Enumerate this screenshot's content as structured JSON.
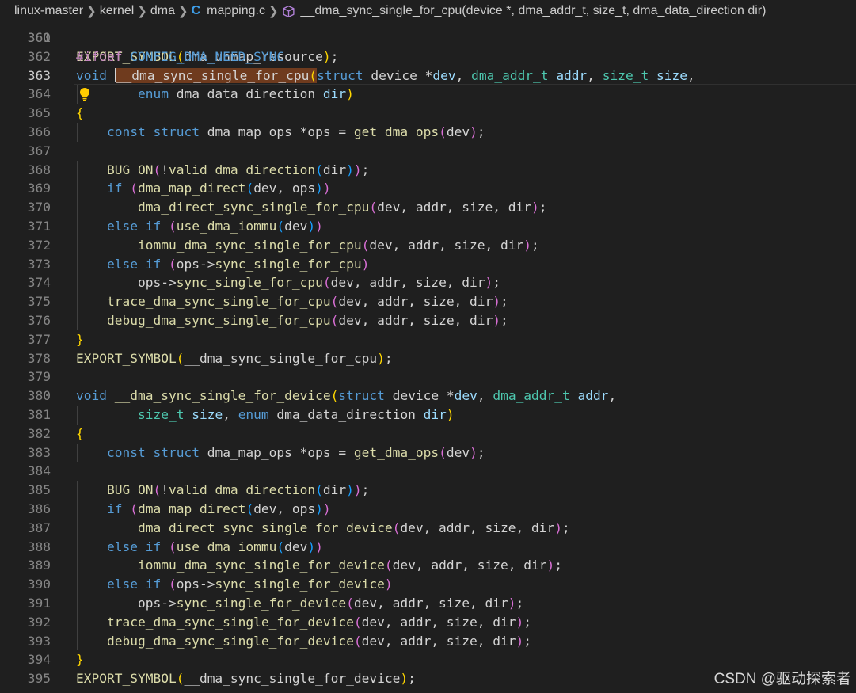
{
  "breadcrumb": {
    "items": [
      "linux-master",
      "kernel",
      "dma",
      "mapping.c",
      "__dma_sync_single_for_cpu(device *, dma_addr_t, size_t, dma_data_direction dir)"
    ],
    "icons": {
      "file": "c-language-file-icon",
      "symbol": "function-cube-icon"
    }
  },
  "partial_top_line": {
    "text": "EXPORT_SYMBOL(dma_unmap_resource);"
  },
  "editor": {
    "cursor_line": "363",
    "lightbulb_line": "364",
    "selected_text": "__dma_sync_single_for_cpu(",
    "lines": [
      {
        "n": "361",
        "t": []
      },
      {
        "n": "362",
        "t": [
          [
            "pp",
            "#ifdef"
          ],
          [
            "tx",
            " "
          ],
          [
            "mac",
            "CONFIG_DMA_NEED_SYNC"
          ]
        ]
      },
      {
        "n": "363",
        "t": [
          [
            "kw",
            "void"
          ],
          [
            "tx",
            " "
          ],
          [
            "cursor",
            ""
          ],
          [
            "sel",
            "__dma_sync_single_for_cpu"
          ],
          [
            "sel b1",
            "("
          ],
          [
            "kw",
            "struct"
          ],
          [
            "tx",
            " device *"
          ],
          [
            "pm",
            "dev"
          ],
          [
            "tx",
            ", "
          ],
          [
            "ty",
            "dma_addr_t"
          ],
          [
            "tx",
            " "
          ],
          [
            "pm",
            "addr"
          ],
          [
            "tx",
            ", "
          ],
          [
            "ty",
            "size_t"
          ],
          [
            "tx",
            " "
          ],
          [
            "pm",
            "size"
          ],
          [
            "tx",
            ","
          ]
        ]
      },
      {
        "n": "364",
        "t": [
          [
            "tx",
            "        "
          ],
          [
            "kw",
            "enum"
          ],
          [
            "tx",
            " dma_data_direction "
          ],
          [
            "pm",
            "dir"
          ],
          [
            "b1",
            ")"
          ]
        ]
      },
      {
        "n": "365",
        "t": [
          [
            "b1",
            "{"
          ]
        ]
      },
      {
        "n": "366",
        "t": [
          [
            "tx",
            "    "
          ],
          [
            "kw",
            "const"
          ],
          [
            "tx",
            " "
          ],
          [
            "kw",
            "struct"
          ],
          [
            "tx",
            " dma_map_ops *ops = "
          ],
          [
            "fn",
            "get_dma_ops"
          ],
          [
            "b2",
            "("
          ],
          [
            "tx",
            "dev"
          ],
          [
            "b2",
            ")"
          ],
          [
            "tx",
            ";"
          ]
        ]
      },
      {
        "n": "367",
        "t": []
      },
      {
        "n": "368",
        "t": [
          [
            "tx",
            "    "
          ],
          [
            "fn",
            "BUG_ON"
          ],
          [
            "b2",
            "("
          ],
          [
            "tx",
            "!"
          ],
          [
            "fn",
            "valid_dma_direction"
          ],
          [
            "b3",
            "("
          ],
          [
            "tx",
            "dir"
          ],
          [
            "b3",
            ")"
          ],
          [
            "b2",
            ")"
          ],
          [
            "tx",
            ";"
          ]
        ]
      },
      {
        "n": "369",
        "t": [
          [
            "tx",
            "    "
          ],
          [
            "kw",
            "if"
          ],
          [
            "tx",
            " "
          ],
          [
            "b2",
            "("
          ],
          [
            "fn",
            "dma_map_direct"
          ],
          [
            "b3",
            "("
          ],
          [
            "tx",
            "dev, ops"
          ],
          [
            "b3",
            ")"
          ],
          [
            "b2",
            ")"
          ]
        ]
      },
      {
        "n": "370",
        "t": [
          [
            "tx",
            "        "
          ],
          [
            "fn",
            "dma_direct_sync_single_for_cpu"
          ],
          [
            "b2",
            "("
          ],
          [
            "tx",
            "dev, addr, size, dir"
          ],
          [
            "b2",
            ")"
          ],
          [
            "tx",
            ";"
          ]
        ]
      },
      {
        "n": "371",
        "t": [
          [
            "tx",
            "    "
          ],
          [
            "kw",
            "else"
          ],
          [
            "tx",
            " "
          ],
          [
            "kw",
            "if"
          ],
          [
            "tx",
            " "
          ],
          [
            "b2",
            "("
          ],
          [
            "fn",
            "use_dma_iommu"
          ],
          [
            "b3",
            "("
          ],
          [
            "tx",
            "dev"
          ],
          [
            "b3",
            ")"
          ],
          [
            "b2",
            ")"
          ]
        ]
      },
      {
        "n": "372",
        "t": [
          [
            "tx",
            "        "
          ],
          [
            "fn",
            "iommu_dma_sync_single_for_cpu"
          ],
          [
            "b2",
            "("
          ],
          [
            "tx",
            "dev, addr, size, dir"
          ],
          [
            "b2",
            ")"
          ],
          [
            "tx",
            ";"
          ]
        ]
      },
      {
        "n": "373",
        "t": [
          [
            "tx",
            "    "
          ],
          [
            "kw",
            "else"
          ],
          [
            "tx",
            " "
          ],
          [
            "kw",
            "if"
          ],
          [
            "tx",
            " "
          ],
          [
            "b2",
            "("
          ],
          [
            "tx",
            "ops->"
          ],
          [
            "fn",
            "sync_single_for_cpu"
          ],
          [
            "b2",
            ")"
          ]
        ]
      },
      {
        "n": "374",
        "t": [
          [
            "tx",
            "        ops->"
          ],
          [
            "fn",
            "sync_single_for_cpu"
          ],
          [
            "b2",
            "("
          ],
          [
            "tx",
            "dev, addr, size, dir"
          ],
          [
            "b2",
            ")"
          ],
          [
            "tx",
            ";"
          ]
        ]
      },
      {
        "n": "375",
        "t": [
          [
            "tx",
            "    "
          ],
          [
            "fn",
            "trace_dma_sync_single_for_cpu"
          ],
          [
            "b2",
            "("
          ],
          [
            "tx",
            "dev, addr, size, dir"
          ],
          [
            "b2",
            ")"
          ],
          [
            "tx",
            ";"
          ]
        ]
      },
      {
        "n": "376",
        "t": [
          [
            "tx",
            "    "
          ],
          [
            "fn",
            "debug_dma_sync_single_for_cpu"
          ],
          [
            "b2",
            "("
          ],
          [
            "tx",
            "dev, addr, size, dir"
          ],
          [
            "b2",
            ")"
          ],
          [
            "tx",
            ";"
          ]
        ]
      },
      {
        "n": "377",
        "t": [
          [
            "b1",
            "}"
          ]
        ]
      },
      {
        "n": "378",
        "t": [
          [
            "fn",
            "EXPORT_SYMBOL"
          ],
          [
            "b1",
            "("
          ],
          [
            "tx",
            "__dma_sync_single_for_cpu"
          ],
          [
            "b1",
            ")"
          ],
          [
            "tx",
            ";"
          ]
        ]
      },
      {
        "n": "379",
        "t": []
      },
      {
        "n": "380",
        "t": [
          [
            "kw",
            "void"
          ],
          [
            "tx",
            " "
          ],
          [
            "fn",
            "__dma_sync_single_for_device"
          ],
          [
            "b1",
            "("
          ],
          [
            "kw",
            "struct"
          ],
          [
            "tx",
            " device *"
          ],
          [
            "pm",
            "dev"
          ],
          [
            "tx",
            ", "
          ],
          [
            "ty",
            "dma_addr_t"
          ],
          [
            "tx",
            " "
          ],
          [
            "pm",
            "addr"
          ],
          [
            "tx",
            ","
          ]
        ]
      },
      {
        "n": "381",
        "t": [
          [
            "tx",
            "        "
          ],
          [
            "ty",
            "size_t"
          ],
          [
            "tx",
            " "
          ],
          [
            "pm",
            "size"
          ],
          [
            "tx",
            ", "
          ],
          [
            "kw",
            "enum"
          ],
          [
            "tx",
            " dma_data_direction "
          ],
          [
            "pm",
            "dir"
          ],
          [
            "b1",
            ")"
          ]
        ]
      },
      {
        "n": "382",
        "t": [
          [
            "b1",
            "{"
          ]
        ]
      },
      {
        "n": "383",
        "t": [
          [
            "tx",
            "    "
          ],
          [
            "kw",
            "const"
          ],
          [
            "tx",
            " "
          ],
          [
            "kw",
            "struct"
          ],
          [
            "tx",
            " dma_map_ops *ops = "
          ],
          [
            "fn",
            "get_dma_ops"
          ],
          [
            "b2",
            "("
          ],
          [
            "tx",
            "dev"
          ],
          [
            "b2",
            ")"
          ],
          [
            "tx",
            ";"
          ]
        ]
      },
      {
        "n": "384",
        "t": []
      },
      {
        "n": "385",
        "t": [
          [
            "tx",
            "    "
          ],
          [
            "fn",
            "BUG_ON"
          ],
          [
            "b2",
            "("
          ],
          [
            "tx",
            "!"
          ],
          [
            "fn",
            "valid_dma_direction"
          ],
          [
            "b3",
            "("
          ],
          [
            "tx",
            "dir"
          ],
          [
            "b3",
            ")"
          ],
          [
            "b2",
            ")"
          ],
          [
            "tx",
            ";"
          ]
        ]
      },
      {
        "n": "386",
        "t": [
          [
            "tx",
            "    "
          ],
          [
            "kw",
            "if"
          ],
          [
            "tx",
            " "
          ],
          [
            "b2",
            "("
          ],
          [
            "fn",
            "dma_map_direct"
          ],
          [
            "b3",
            "("
          ],
          [
            "tx",
            "dev, ops"
          ],
          [
            "b3",
            ")"
          ],
          [
            "b2",
            ")"
          ]
        ]
      },
      {
        "n": "387",
        "t": [
          [
            "tx",
            "        "
          ],
          [
            "fn",
            "dma_direct_sync_single_for_device"
          ],
          [
            "b2",
            "("
          ],
          [
            "tx",
            "dev, addr, size, dir"
          ],
          [
            "b2",
            ")"
          ],
          [
            "tx",
            ";"
          ]
        ]
      },
      {
        "n": "388",
        "t": [
          [
            "tx",
            "    "
          ],
          [
            "kw",
            "else"
          ],
          [
            "tx",
            " "
          ],
          [
            "kw",
            "if"
          ],
          [
            "tx",
            " "
          ],
          [
            "b2",
            "("
          ],
          [
            "fn",
            "use_dma_iommu"
          ],
          [
            "b3",
            "("
          ],
          [
            "tx",
            "dev"
          ],
          [
            "b3",
            ")"
          ],
          [
            "b2",
            ")"
          ]
        ]
      },
      {
        "n": "389",
        "t": [
          [
            "tx",
            "        "
          ],
          [
            "fn",
            "iommu_dma_sync_single_for_device"
          ],
          [
            "b2",
            "("
          ],
          [
            "tx",
            "dev, addr, size, dir"
          ],
          [
            "b2",
            ")"
          ],
          [
            "tx",
            ";"
          ]
        ]
      },
      {
        "n": "390",
        "t": [
          [
            "tx",
            "    "
          ],
          [
            "kw",
            "else"
          ],
          [
            "tx",
            " "
          ],
          [
            "kw",
            "if"
          ],
          [
            "tx",
            " "
          ],
          [
            "b2",
            "("
          ],
          [
            "tx",
            "ops->"
          ],
          [
            "fn",
            "sync_single_for_device"
          ],
          [
            "b2",
            ")"
          ]
        ]
      },
      {
        "n": "391",
        "t": [
          [
            "tx",
            "        ops->"
          ],
          [
            "fn",
            "sync_single_for_device"
          ],
          [
            "b2",
            "("
          ],
          [
            "tx",
            "dev, addr, size, dir"
          ],
          [
            "b2",
            ")"
          ],
          [
            "tx",
            ";"
          ]
        ]
      },
      {
        "n": "392",
        "t": [
          [
            "tx",
            "    "
          ],
          [
            "fn",
            "trace_dma_sync_single_for_device"
          ],
          [
            "b2",
            "("
          ],
          [
            "tx",
            "dev, addr, size, dir"
          ],
          [
            "b2",
            ")"
          ],
          [
            "tx",
            ";"
          ]
        ]
      },
      {
        "n": "393",
        "t": [
          [
            "tx",
            "    "
          ],
          [
            "fn",
            "debug_dma_sync_single_for_device"
          ],
          [
            "b2",
            "("
          ],
          [
            "tx",
            "dev, addr, size, dir"
          ],
          [
            "b2",
            ")"
          ],
          [
            "tx",
            ";"
          ]
        ]
      },
      {
        "n": "394",
        "t": [
          [
            "b1",
            "}"
          ]
        ]
      },
      {
        "n": "395",
        "t": [
          [
            "fn",
            "EXPORT_SYMBOL"
          ],
          [
            "b1",
            "("
          ],
          [
            "tx",
            "__dma_sync_single_for_device"
          ],
          [
            "b1",
            ")"
          ],
          [
            "tx",
            ";"
          ]
        ]
      }
    ]
  },
  "watermark": {
    "text": "CSDN @驱动探索者"
  },
  "colors": {
    "background": "#1f1f1f",
    "keyword": "#569cd6",
    "function": "#dcdcaa",
    "type": "#4ec9b0",
    "parameter": "#9cdcfe",
    "preprocessor": "#c586c0",
    "bracket1": "#ffd700",
    "bracket2": "#da70d6",
    "bracket3": "#179fff",
    "selection": "#6f3b1e"
  }
}
